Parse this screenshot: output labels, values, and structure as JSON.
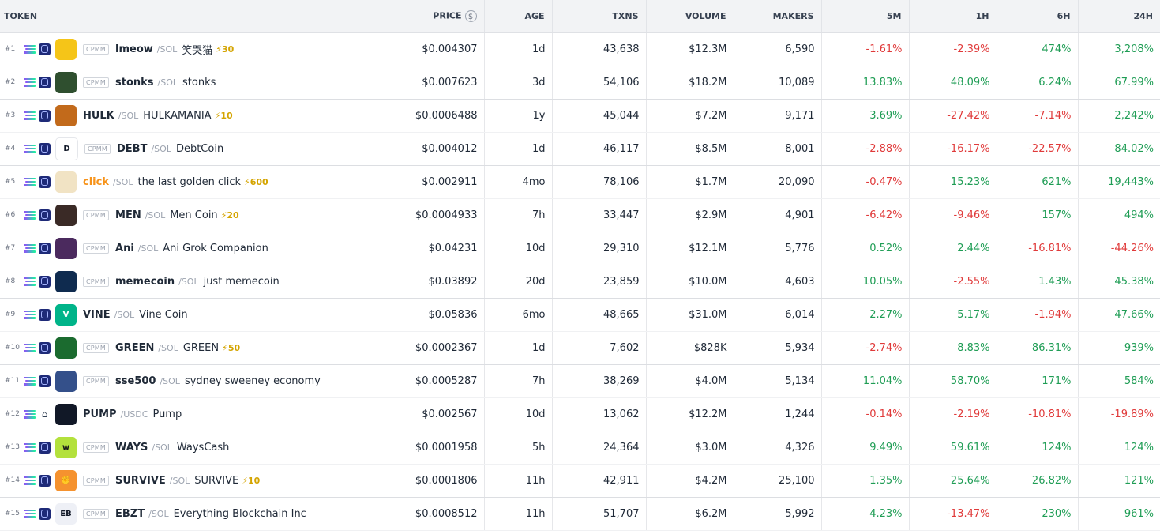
{
  "columns": {
    "token": "TOKEN",
    "price": "PRICE",
    "price_icon": "$",
    "age": "AGE",
    "txns": "TXNS",
    "volume": "VOLUME",
    "makers": "MAKERS",
    "m5": "5M",
    "h1": "1H",
    "h6": "6H",
    "h24": "24H"
  },
  "colors": {
    "positive": "#1f9d55",
    "negative": "#e03a3a",
    "boost": "#d4a400",
    "highlight_symbol": "#f7931a"
  },
  "rows": [
    {
      "rank": "#1",
      "chain": "solana-icon",
      "dex": "raydium-icon",
      "badge": "CPMM",
      "symbol": "lmeow",
      "quote": "/SOL",
      "name": "笑哭猫",
      "boost": "30",
      "price": "$0.004307",
      "age": "1d",
      "txns": "43,638",
      "volume": "$12.3M",
      "makers": "6,590",
      "m5": "-1.61%",
      "h1": "-2.39%",
      "h6": "474%",
      "h24": "3,208%",
      "avatar": {
        "bg": "#f5c518",
        "text": ""
      }
    },
    {
      "rank": "#2",
      "chain": "solana-icon",
      "dex": "raydium-icon",
      "badge": "CPMM",
      "symbol": "stonks",
      "quote": "/SOL",
      "name": "stonks",
      "boost": "",
      "price": "$0.007623",
      "age": "3d",
      "txns": "54,106",
      "volume": "$18.2M",
      "makers": "10,089",
      "m5": "13.83%",
      "h1": "48.09%",
      "h6": "6.24%",
      "h24": "67.99%",
      "avatar": {
        "bg": "#2f4f2f",
        "text": ""
      }
    },
    {
      "rank": "#3",
      "chain": "solana-icon",
      "dex": "raydium-icon",
      "badge": "",
      "symbol": "HULK",
      "quote": "/SOL",
      "name": "HULKAMANIA",
      "boost": "10",
      "price": "$0.0006488",
      "age": "1y",
      "txns": "45,044",
      "volume": "$7.2M",
      "makers": "9,171",
      "m5": "3.69%",
      "h1": "-27.42%",
      "h6": "-7.14%",
      "h24": "2,242%",
      "avatar": {
        "bg": "#c26a1b",
        "text": ""
      }
    },
    {
      "rank": "#4",
      "chain": "solana-icon",
      "dex": "raydium-icon",
      "badge": "CPMM",
      "symbol": "DEBT",
      "quote": "/SOL",
      "name": "DebtCoin",
      "boost": "",
      "price": "$0.004012",
      "age": "1d",
      "txns": "46,117",
      "volume": "$8.5M",
      "makers": "8,001",
      "m5": "-2.88%",
      "h1": "-16.17%",
      "h6": "-22.57%",
      "h24": "84.02%",
      "avatar": {
        "bg": "#ffffff",
        "text": "D"
      }
    },
    {
      "rank": "#5",
      "chain": "solana-icon",
      "dex": "raydium-icon",
      "badge": "",
      "symbol": "click",
      "quote": "/SOL",
      "name": "the last golden click",
      "boost": "600",
      "price": "$0.002911",
      "age": "4mo",
      "txns": "78,106",
      "volume": "$1.7M",
      "makers": "20,090",
      "m5": "-0.47%",
      "h1": "15.23%",
      "h6": "621%",
      "h24": "19,443%",
      "avatar": {
        "bg": "#f1e3c4",
        "text": ""
      }
    },
    {
      "rank": "#6",
      "chain": "solana-icon",
      "dex": "raydium-icon",
      "badge": "CPMM",
      "symbol": "MEN",
      "quote": "/SOL",
      "name": "Men Coin",
      "boost": "20",
      "price": "$0.0004933",
      "age": "7h",
      "txns": "33,447",
      "volume": "$2.9M",
      "makers": "4,901",
      "m5": "-6.42%",
      "h1": "-9.46%",
      "h6": "157%",
      "h24": "494%",
      "avatar": {
        "bg": "#3a2a26",
        "text": ""
      }
    },
    {
      "rank": "#7",
      "chain": "solana-icon",
      "dex": "raydium-icon",
      "badge": "CPMM",
      "symbol": "Ani",
      "quote": "/SOL",
      "name": "Ani Grok Companion",
      "boost": "",
      "price": "$0.04231",
      "age": "10d",
      "txns": "29,310",
      "volume": "$12.1M",
      "makers": "5,776",
      "m5": "0.52%",
      "h1": "2.44%",
      "h6": "-16.81%",
      "h24": "-44.26%",
      "avatar": {
        "bg": "#4b2a5e",
        "text": ""
      }
    },
    {
      "rank": "#8",
      "chain": "solana-icon",
      "dex": "raydium-icon",
      "badge": "CPMM",
      "symbol": "memecoin",
      "quote": "/SOL",
      "name": "just memecoin",
      "boost": "",
      "price": "$0.03892",
      "age": "20d",
      "txns": "23,859",
      "volume": "$10.0M",
      "makers": "4,603",
      "m5": "10.05%",
      "h1": "-2.55%",
      "h6": "1.43%",
      "h24": "45.38%",
      "avatar": {
        "bg": "#0f2b4f",
        "text": ""
      }
    },
    {
      "rank": "#9",
      "chain": "solana-icon",
      "dex": "raydium-icon",
      "badge": "",
      "symbol": "VINE",
      "quote": "/SOL",
      "name": "Vine Coin",
      "boost": "",
      "price": "$0.05836",
      "age": "6mo",
      "txns": "48,665",
      "volume": "$31.0M",
      "makers": "6,014",
      "m5": "2.27%",
      "h1": "5.17%",
      "h6": "-1.94%",
      "h24": "47.66%",
      "avatar": {
        "bg": "#00b489",
        "text": "V"
      }
    },
    {
      "rank": "#10",
      "chain": "solana-icon",
      "dex": "raydium-icon",
      "badge": "CPMM",
      "symbol": "GREEN",
      "quote": "/SOL",
      "name": "GREEN",
      "boost": "50",
      "price": "$0.0002367",
      "age": "1d",
      "txns": "7,602",
      "volume": "$828K",
      "makers": "5,934",
      "m5": "-2.74%",
      "h1": "8.83%",
      "h6": "86.31%",
      "h24": "939%",
      "avatar": {
        "bg": "#1b6b2f",
        "text": ""
      }
    },
    {
      "rank": "#11",
      "chain": "solana-icon",
      "dex": "raydium-icon",
      "badge": "CPMM",
      "symbol": "sse500",
      "quote": "/SOL",
      "name": "sydney sweeney economy",
      "boost": "",
      "price": "$0.0005287",
      "age": "7h",
      "txns": "38,269",
      "volume": "$4.0M",
      "makers": "5,134",
      "m5": "11.04%",
      "h1": "58.70%",
      "h6": "171%",
      "h24": "584%",
      "avatar": {
        "bg": "#34508a",
        "text": ""
      }
    },
    {
      "rank": "#12",
      "chain": "solana-icon",
      "dex": "orca-icon",
      "badge": "",
      "symbol": "PUMP",
      "quote": "/USDC",
      "name": "Pump",
      "boost": "",
      "price": "$0.002567",
      "age": "10d",
      "txns": "13,062",
      "volume": "$12.2M",
      "makers": "1,244",
      "m5": "-0.14%",
      "h1": "-2.19%",
      "h6": "-10.81%",
      "h24": "-19.89%",
      "avatar": {
        "bg": "#111827",
        "text": ""
      }
    },
    {
      "rank": "#13",
      "chain": "solana-icon",
      "dex": "raydium-icon",
      "badge": "CPMM",
      "symbol": "WAYS",
      "quote": "/SOL",
      "name": "WaysCash",
      "boost": "",
      "price": "$0.0001958",
      "age": "5h",
      "txns": "24,364",
      "volume": "$3.0M",
      "makers": "4,326",
      "m5": "9.49%",
      "h1": "59.61%",
      "h6": "124%",
      "h24": "124%",
      "avatar": {
        "bg": "#b3e13c",
        "text": "w"
      }
    },
    {
      "rank": "#14",
      "chain": "solana-icon",
      "dex": "raydium-icon",
      "badge": "CPMM",
      "symbol": "SURVIVE",
      "quote": "/SOL",
      "name": "SURVIVE",
      "boost": "10",
      "price": "$0.0001806",
      "age": "11h",
      "txns": "42,911",
      "volume": "$4.2M",
      "makers": "25,100",
      "m5": "1.35%",
      "h1": "25.64%",
      "h6": "26.82%",
      "h24": "121%",
      "avatar": {
        "bg": "#f5922f",
        "text": "✊"
      }
    },
    {
      "rank": "#15",
      "chain": "solana-icon",
      "dex": "raydium-icon",
      "badge": "CPMM",
      "symbol": "EBZT",
      "quote": "/SOL",
      "name": "Everything Blockchain Inc",
      "boost": "",
      "price": "$0.0008512",
      "age": "11h",
      "txns": "51,707",
      "volume": "$6.2M",
      "makers": "5,992",
      "m5": "4.23%",
      "h1": "-13.47%",
      "h6": "230%",
      "h24": "961%",
      "avatar": {
        "bg": "#eef0f6",
        "text": "EB"
      }
    }
  ]
}
